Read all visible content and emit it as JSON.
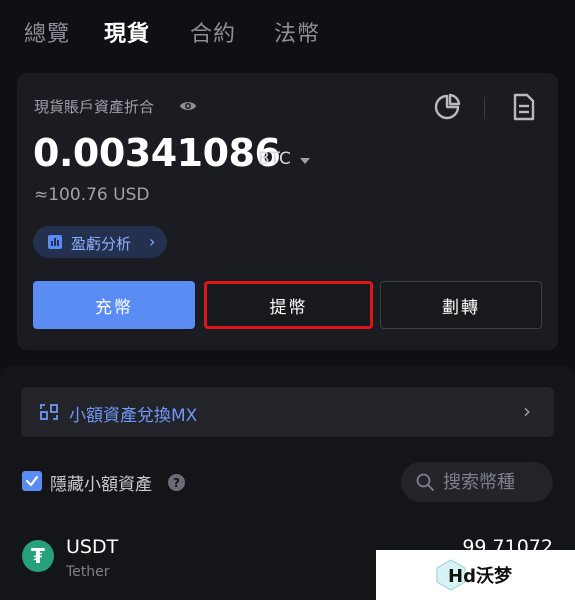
{
  "top_tabs": [
    {
      "label": "總覽"
    },
    {
      "label": "現貨"
    },
    {
      "label": "合約"
    },
    {
      "label": "法幣"
    }
  ],
  "active_tab": "現貨",
  "account": {
    "label": "現貨賬戶資產折合",
    "balance": "0.00341086",
    "currency": "BTC",
    "usd_value": "≈100.76 USD",
    "pnl_label": "盈虧分析",
    "pnl_chevron": "›"
  },
  "actions": {
    "deposit": "充幣",
    "withdraw": "提幣",
    "transfer": "劃轉"
  },
  "convert": {
    "label": "小額資產兌換MX",
    "chevron": "›"
  },
  "filter": {
    "hide_small_label": "隱藏小額資產",
    "hide_small_checked": true,
    "help": "?"
  },
  "search": {
    "placeholder": "搜索幣種"
  },
  "assets": [
    {
      "symbol": "USDT",
      "name": "Tether",
      "amount": "99.71072",
      "icon_glyph": "₮"
    }
  ],
  "watermark": {
    "text": "Hd沃梦"
  },
  "colors": {
    "accent": "#5b8cf4",
    "highlight_border": "#e0141b",
    "tether": "#26a17b"
  }
}
